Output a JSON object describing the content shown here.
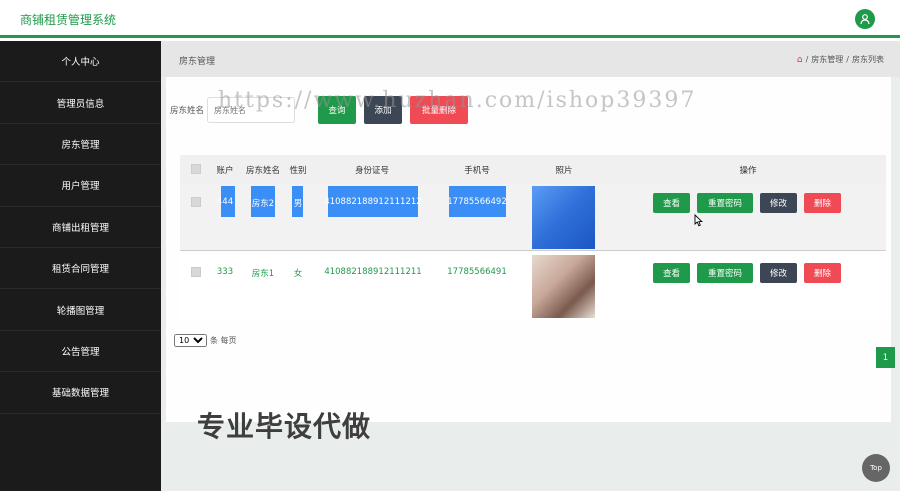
{
  "app": {
    "title": "商铺租赁管理系统"
  },
  "sidebar": {
    "items": [
      {
        "label": "个人中心"
      },
      {
        "label": "管理员信息"
      },
      {
        "label": "房东管理"
      },
      {
        "label": "用户管理"
      },
      {
        "label": "商铺出租管理"
      },
      {
        "label": "租赁合同管理"
      },
      {
        "label": "轮播图管理"
      },
      {
        "label": "公告管理"
      },
      {
        "label": "基础数据管理"
      }
    ]
  },
  "breadcrumb": {
    "title": "房东管理",
    "path": [
      "房东管理",
      "房东列表"
    ],
    "separator": "/"
  },
  "search": {
    "label": "房东姓名",
    "placeholder": "房东姓名",
    "search_button": "查询",
    "add_button": "添加",
    "batch_delete_button": "批量删除"
  },
  "watermark": "https://www.huzhan.com/ishop39397",
  "table": {
    "headers": [
      "账户",
      "房东姓名",
      "性别",
      "身份证号",
      "手机号",
      "照片",
      "操作"
    ],
    "rows": [
      {
        "account": "444",
        "name": "房东2",
        "gender": "男",
        "id_number": "410882188912111212",
        "phone": "17785566492"
      },
      {
        "account": "333",
        "name": "房东1",
        "gender": "女",
        "id_number": "410882188912111211",
        "phone": "17785566491"
      }
    ],
    "actions": {
      "view": "查看",
      "reset_password": "重置密码",
      "edit": "修改",
      "delete": "删除"
    }
  },
  "pagination": {
    "page_size": "10",
    "page_size_suffix": "条 每页",
    "current_page": "1"
  },
  "promo_text": "专业毕设代做",
  "top_button": "Top",
  "colors": {
    "accent": "#1e9a4a",
    "danger": "#f04a55",
    "dark": "#3d4654",
    "sidebar": "#1b1b1b",
    "highlight": "#3b8ef5"
  }
}
